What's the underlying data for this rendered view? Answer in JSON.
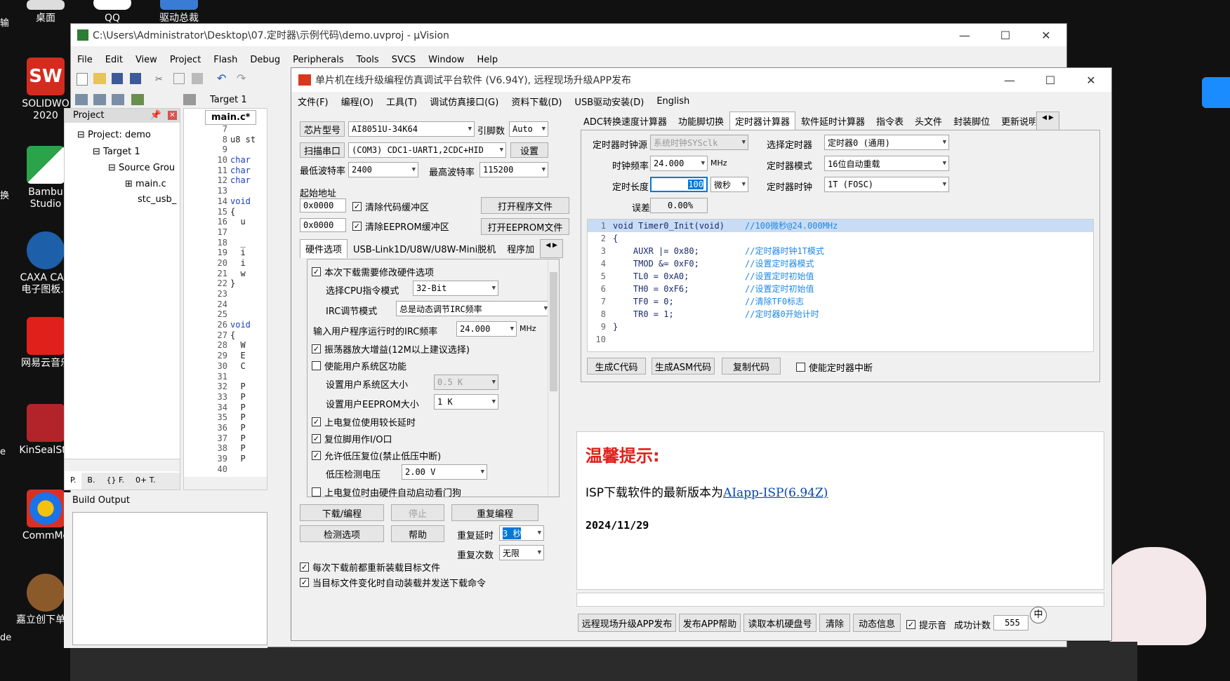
{
  "desktop": {
    "icons": [
      {
        "label": "桌面"
      },
      {
        "label": "QQ"
      },
      {
        "label": "驱动总裁"
      },
      {
        "label": "SOLIDWO 2020"
      },
      {
        "label": "Bambu Studio"
      },
      {
        "label": "CAXA CAD 电子图板..."
      },
      {
        "label": "网易云音乐"
      },
      {
        "label": "KinSealStu"
      },
      {
        "label": "CommMo"
      },
      {
        "label": "嘉立创下单手"
      }
    ],
    "left_edge_texts": [
      "输",
      "换",
      "e",
      "de"
    ]
  },
  "uvision": {
    "title": "C:\\Users\\Administrator\\Desktop\\07.定时器\\示例代码\\demo.uvproj - µVision",
    "menu": [
      "File",
      "Edit",
      "View",
      "Project",
      "Flash",
      "Debug",
      "Peripherals",
      "Tools",
      "SVCS",
      "Window",
      "Help"
    ],
    "target": "Target 1",
    "project_panel_title": "Project",
    "tree": [
      "Project: demo",
      "Target 1",
      "Source Grou",
      "main.c",
      "stc_usb_"
    ],
    "editor_tab": "main.c*",
    "code_lines": [
      {
        "n": "7",
        "t": ""
      },
      {
        "n": "8",
        "t": "u8 st"
      },
      {
        "n": "9",
        "t": ""
      },
      {
        "n": "10",
        "t": "char"
      },
      {
        "n": "11",
        "t": "char"
      },
      {
        "n": "12",
        "t": "char"
      },
      {
        "n": "13",
        "t": ""
      },
      {
        "n": "14",
        "t": "void"
      },
      {
        "n": "15",
        "t": "{"
      },
      {
        "n": "16",
        "t": "  u"
      },
      {
        "n": "17",
        "t": ""
      },
      {
        "n": "18",
        "t": "  _"
      },
      {
        "n": "19",
        "t": "  i"
      },
      {
        "n": "20",
        "t": "  i"
      },
      {
        "n": "21",
        "t": "  w"
      },
      {
        "n": "22",
        "t": "}"
      },
      {
        "n": "23",
        "t": ""
      },
      {
        "n": "24",
        "t": ""
      },
      {
        "n": "25",
        "t": ""
      },
      {
        "n": "26",
        "t": "void"
      },
      {
        "n": "27",
        "t": "{"
      },
      {
        "n": "28",
        "t": "  W"
      },
      {
        "n": "29",
        "t": "  E"
      },
      {
        "n": "30",
        "t": "  C"
      },
      {
        "n": "31",
        "t": ""
      },
      {
        "n": "32",
        "t": "  P"
      },
      {
        "n": "33",
        "t": "  P"
      },
      {
        "n": "34",
        "t": "  P"
      },
      {
        "n": "35",
        "t": "  P"
      },
      {
        "n": "36",
        "t": "  P"
      },
      {
        "n": "37",
        "t": "  P"
      },
      {
        "n": "38",
        "t": "  P"
      },
      {
        "n": "39",
        "t": "  P"
      },
      {
        "n": "40",
        "t": ""
      }
    ],
    "bottom_tabs": [
      "P.",
      "B.",
      "{} F.",
      "0+ T."
    ],
    "build_output": "Build Output"
  },
  "isp": {
    "title": "单片机在线升级编程仿真调试平台软件 (V6.94Y), 远程现场升级APP发布",
    "menu": [
      "文件(F)",
      "编程(O)",
      "工具(T)",
      "调试仿真接口(G)",
      "资料下载(D)",
      "USB驱动安装(D)",
      "English"
    ],
    "chip_label": "芯片型号",
    "chip_value": "AI8051U-34K64",
    "pin_label": "引脚数",
    "pin_value": "Auto",
    "scan_button": "扫描串口",
    "port_value": "(COM3) CDC1-UART1,2CDC+HID",
    "settings_button": "设置",
    "min_baud_label": "最低波特率",
    "min_baud_value": "2400",
    "max_baud_label": "最高波特率",
    "max_baud_value": "115200",
    "start_addr_label": "起始地址",
    "addr1": "0x0000",
    "clear_code": "清除代码缓冲区",
    "open_prog": "打开程序文件",
    "addr2": "0x0000",
    "clear_eeprom": "清除EEPROM缓冲区",
    "open_eeprom": "打开EEPROM文件",
    "left_tabs": [
      "硬件选项",
      "USB-Link1D/U8W/U8W-Mini脱机",
      "程序加"
    ],
    "hw": {
      "modify_opts": "本次下载需要修改硬件选项",
      "cpu_mode_label": "选择CPU指令模式",
      "cpu_mode_value": "32-Bit",
      "irc_mode_label": "IRC调节模式",
      "irc_mode_value": "总是动态调节IRC频率",
      "irc_freq_label": "输入用户程序运行时的IRC频率",
      "irc_freq_value": "24.000",
      "irc_freq_unit": "MHz",
      "osc_gain": "振荡器放大增益(12M以上建议选择)",
      "user_sys": "使能用户系统区功能",
      "user_sys_size_label": "设置用户系统区大小",
      "user_sys_size_value": "0.5 K",
      "user_eeprom_label": "设置用户EEPROM大小",
      "user_eeprom_value": "1  K",
      "long_delay": "上电复位使用较长延时",
      "reset_io": "复位脚用作I/O口",
      "lvr": "允许低压复位(禁止低压中断)",
      "lvd_label": "低压检测电压",
      "lvd_value": "2.00 V",
      "wdt": "上电复位时由硬件自动启动看门狗"
    },
    "download_button": "下载/编程",
    "stop_button": "停止",
    "reprogram_button": "重复编程",
    "check_button": "检测选项",
    "help_button": "帮助",
    "repeat_delay_label": "重复延时",
    "repeat_delay_value": "3 秒",
    "repeat_count_label": "重复次数",
    "repeat_count_value": "无限",
    "reload_each": "每次下载前都重新装载目标文件",
    "auto_reload": "当目标文件变化时自动装载并发送下载命令",
    "right_tabs": [
      "ADC转换速度计算器",
      "功能脚切换",
      "定时器计算器",
      "软件延时计算器",
      "指令表",
      "头文件",
      "封装脚位",
      "更新说明"
    ],
    "timer": {
      "clock_src_label": "定时器时钟源",
      "clock_src_value": "系统时钟SYSclk",
      "select_timer_label": "选择定时器",
      "select_timer_value": "定时器0 (通用)",
      "clk_freq_label": "时钟频率",
      "clk_freq_value": "24.000",
      "clk_freq_unit": "MHz",
      "timer_mode_label": "定时器模式",
      "timer_mode_value": "16位自动重载",
      "length_label": "定时长度",
      "length_value": "100",
      "length_unit": "微秒",
      "timer_clk_label": "定时器时钟",
      "timer_clk_value": "1T   (FOSC)",
      "error_label": "误差",
      "error_value": "0.00%"
    },
    "gen_code": [
      {
        "n": "1",
        "code": "void Timer0_Init(void)",
        "cmt": "//100微秒@24.000MHz"
      },
      {
        "n": "2",
        "code": "{",
        "cmt": ""
      },
      {
        "n": "3",
        "code": "    AUXR |= 0x80;",
        "cmt": "//定时器时钟1T模式"
      },
      {
        "n": "4",
        "code": "    TMOD &= 0xF0;",
        "cmt": "//设置定时器模式"
      },
      {
        "n": "5",
        "code": "    TL0 = 0xA0;",
        "cmt": "//设置定时初始值"
      },
      {
        "n": "6",
        "code": "    TH0 = 0xF6;",
        "cmt": "//设置定时初始值"
      },
      {
        "n": "7",
        "code": "    TF0 = 0;",
        "cmt": "//清除TF0标志"
      },
      {
        "n": "8",
        "code": "    TR0 = 1;",
        "cmt": "//定时器0开始计时"
      },
      {
        "n": "9",
        "code": "}",
        "cmt": ""
      },
      {
        "n": "10",
        "code": "",
        "cmt": ""
      }
    ],
    "gen_c_button": "生成C代码",
    "gen_asm_button": "生成ASM代码",
    "copy_button": "复制代码",
    "enable_int": "使能定时器中断",
    "tip_title": "温馨提示:",
    "tip_text": "ISP下载软件的最新版本为",
    "tip_link": "AIapp-ISP(6.94Z)",
    "tip_date": "2024/11/29",
    "bottom_buttons": [
      "远程现场升级APP发布",
      "发布APP帮助",
      "读取本机硬盘号",
      "清除",
      "动态信息"
    ],
    "sound_label": "提示音",
    "success_label": "成功计数",
    "success_value": "555",
    "ime_label": "中"
  },
  "colors": {
    "accent_blue": "#0078d7",
    "tip_red": "#e0201b",
    "link_blue": "#0645ad",
    "code_comment": "#1e88e5",
    "highlight": "#c8dcf5"
  }
}
